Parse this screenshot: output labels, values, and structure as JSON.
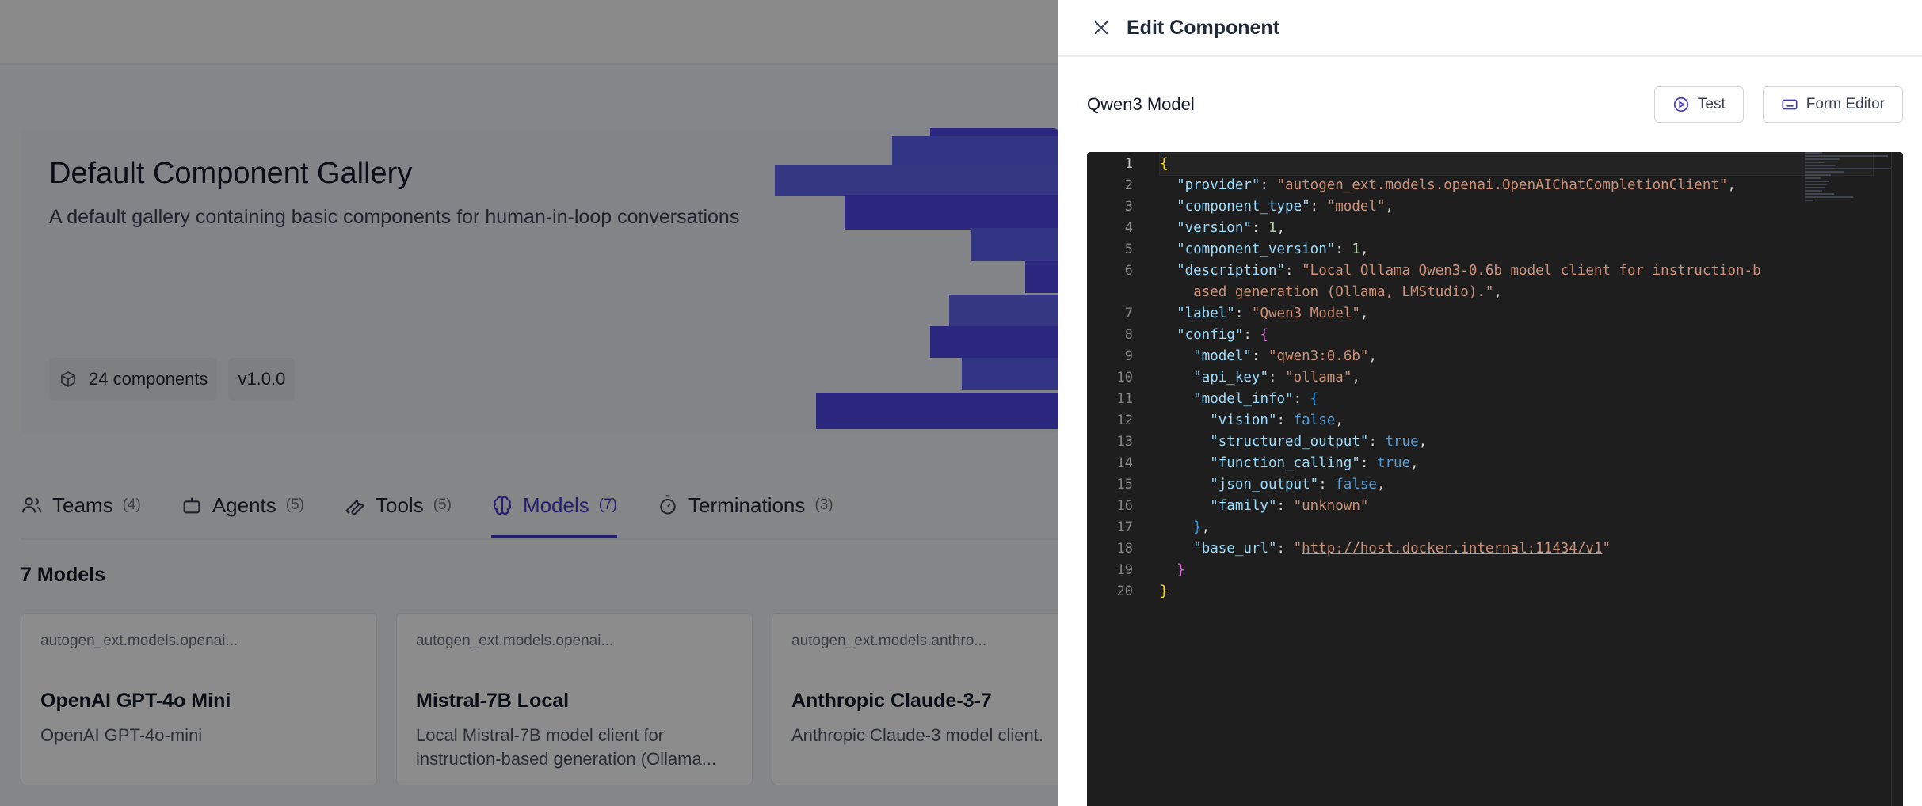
{
  "gallery": {
    "title": "Default Component Gallery",
    "description": "A default gallery containing basic components for human-in-loop conversations",
    "components_badge": "24 components",
    "version_badge": "v1.0.0"
  },
  "tabs": [
    {
      "label": "Teams",
      "count": "(4)",
      "icon": "users-icon"
    },
    {
      "label": "Agents",
      "count": "(5)",
      "icon": "bot-icon"
    },
    {
      "label": "Tools",
      "count": "(5)",
      "icon": "wrench-icon"
    },
    {
      "label": "Models",
      "count": "(7)",
      "icon": "brain-icon",
      "active": true
    },
    {
      "label": "Terminations",
      "count": "(3)",
      "icon": "timer-icon"
    }
  ],
  "section_title": "7 Models",
  "cards": [
    {
      "provider": "autogen_ext.models.openai...",
      "title": "OpenAI GPT-4o Mini",
      "description": "OpenAI GPT-4o-mini"
    },
    {
      "provider": "autogen_ext.models.openai...",
      "title": "Mistral-7B Local",
      "description": "Local Mistral-7B model client for instruction-based generation (Ollama..."
    },
    {
      "provider": "autogen_ext.models.anthro...",
      "title": "Anthropic Claude-3-7",
      "description": "Anthropic Claude-3 model client."
    }
  ],
  "drawer": {
    "title": "Edit Component",
    "component_name": "Qwen3 Model",
    "test_label": "Test",
    "form_editor_label": "Form Editor"
  },
  "colors": {
    "accent": "#4338ca",
    "editor_bg": "#1e1e1e",
    "json_key": "#9cdcfe",
    "json_string": "#ce9178",
    "json_number": "#b5cea8",
    "json_boolean": "#569cd6"
  },
  "code": {
    "line_numbers": [
      "1",
      "2",
      "3",
      "4",
      "5",
      "6",
      "",
      "7",
      "8",
      "9",
      "10",
      "11",
      "12",
      "13",
      "14",
      "15",
      "16",
      "17",
      "18",
      "19",
      "20"
    ],
    "provider": "\"autogen_ext.models.openai.OpenAIChatCompletionClient\"",
    "component_type": "\"model\"",
    "version": "1",
    "component_version": "1",
    "description_part1": "\"Local Ollama Qwen3-0.6b model client for instruction-b",
    "description_part2": "ased generation (Ollama, LMStudio).\"",
    "label": "\"Qwen3 Model\"",
    "model": "\"qwen3:0.6b\"",
    "api_key": "\"ollama\"",
    "vision": "false",
    "structured_output": "true",
    "function_calling": "true",
    "json_output": "false",
    "family": "\"unknown\"",
    "base_url_open": "\"",
    "base_url": "http://host.docker.internal:11434/v1",
    "base_url_close": "\""
  }
}
